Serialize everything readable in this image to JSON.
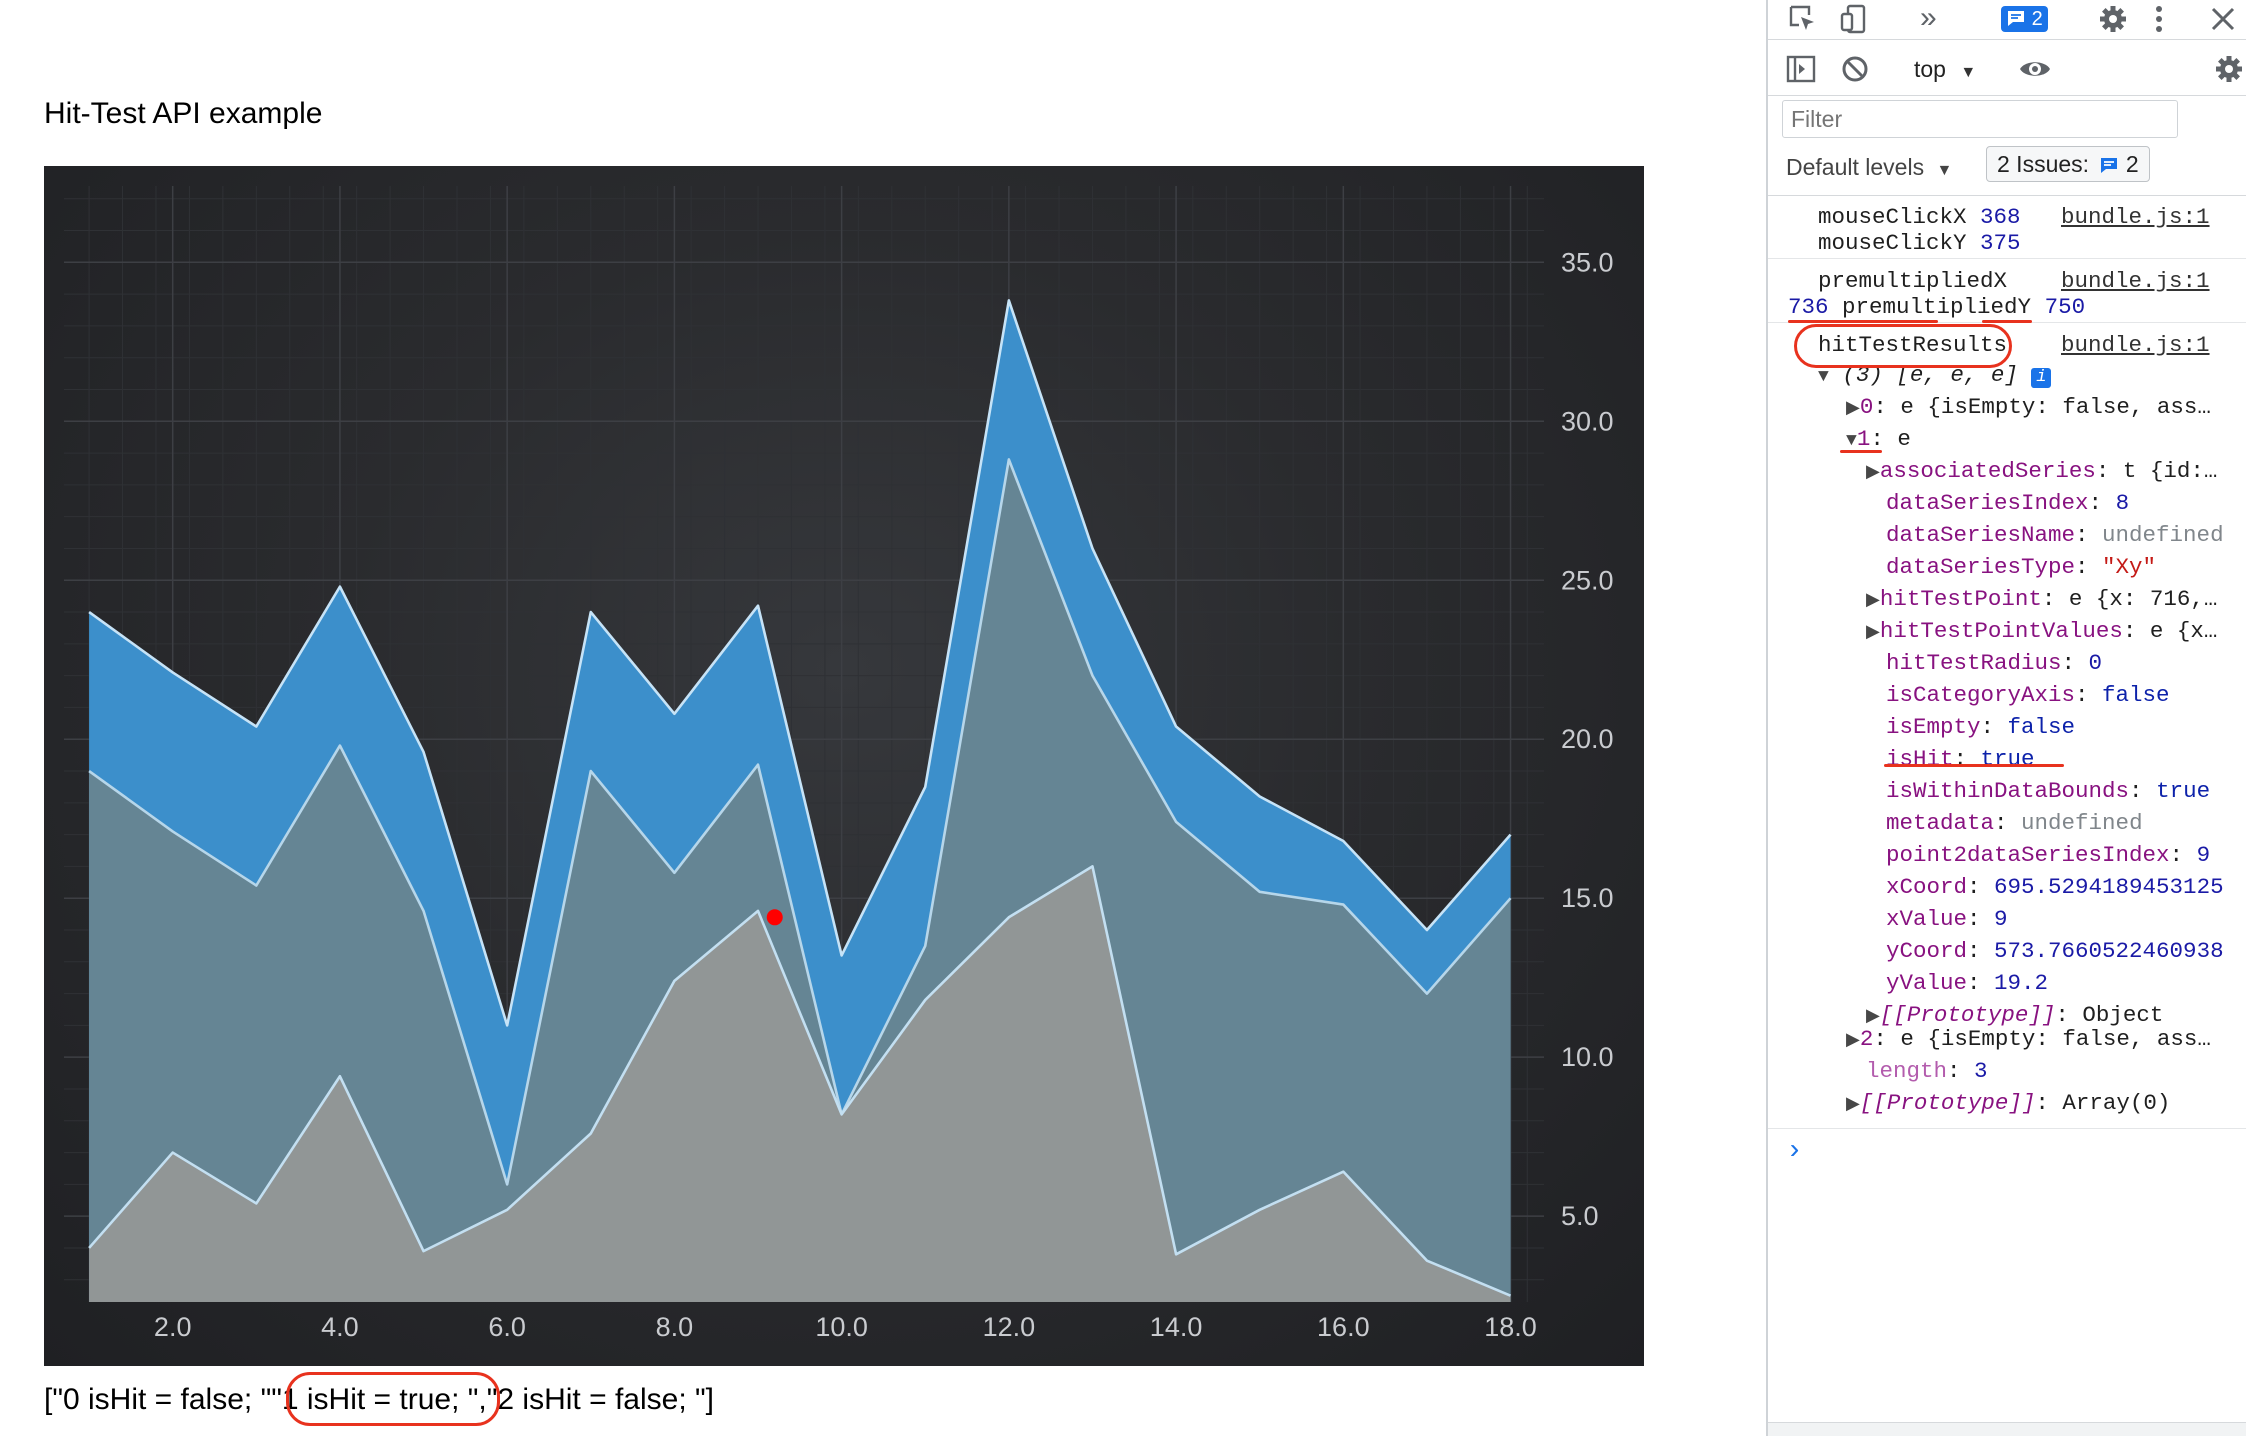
{
  "page": {
    "title": "Hit-Test API example",
    "result_parts": [
      "[\"0 isHit = false; \"",
      "\"1 isHit = true; \"",
      ",\"2 isHit = false; \"]"
    ],
    "point_marker_color": "#ff0000"
  },
  "chart_data": {
    "type": "area",
    "x": [
      1,
      2,
      3,
      4,
      5,
      6,
      7,
      8,
      9,
      10,
      11,
      12,
      13,
      14,
      15,
      16,
      17,
      18
    ],
    "ylim": [
      2.3,
      37.4
    ],
    "xlim": [
      0.7,
      18.4
    ],
    "y_ticks": [
      "35.0",
      "30.0",
      "25.0",
      "20.0",
      "15.0",
      "10.0",
      "5.0"
    ],
    "x_ticks": [
      "2.0",
      "4.0",
      "6.0",
      "8.0",
      "10.0",
      "12.0",
      "14.0",
      "16.0",
      "18.0"
    ],
    "series": [
      {
        "values": [
          24.0,
          22.1,
          20.4,
          24.8,
          19.6,
          11.0,
          24.0,
          20.8,
          24.2,
          13.2,
          18.5,
          33.8,
          26.0,
          20.4,
          18.2,
          16.8,
          14.0,
          17.0
        ],
        "fill": "#3c8fcb",
        "stroke": "#c6e3f7"
      },
      {
        "values": [
          19.0,
          17.1,
          15.4,
          19.8,
          14.6,
          6.0,
          19.0,
          15.8,
          19.2,
          8.2,
          13.5,
          28.8,
          22.0,
          17.4,
          15.2,
          14.8,
          12.0,
          15.0
        ],
        "fill": "#658594",
        "stroke": "#b6d6ea"
      },
      {
        "values": [
          4.0,
          7.0,
          5.4,
          9.4,
          3.9,
          5.2,
          7.6,
          12.4,
          14.6,
          8.2,
          11.8,
          14.4,
          16.0,
          3.8,
          5.2,
          6.4,
          3.6,
          2.5
        ],
        "fill": "#919696",
        "stroke": "#c3dff1"
      }
    ],
    "hit_point": {
      "x": 9.2,
      "y": 14.4
    },
    "grid": true
  },
  "devtools": {
    "issues_count": "2",
    "context_label": "top",
    "filter_placeholder": "Filter",
    "levels_label": "Default levels",
    "issues_label": "2 Issues:",
    "issues_badge": "2",
    "entries": {
      "e1_line1_key": "mouseClickX ",
      "e1_line1_val": "368",
      "e1_line2_key": "mouseClickY ",
      "e1_line2_val": "375",
      "e2_line1_key": "premultipliedX",
      "e2_line2_val1": "736",
      "e2_line2_key": " premultipliedY ",
      "e2_line2_val2": "750",
      "e3_label": "hitTestResults",
      "source": "bundle.js:1"
    },
    "tree": {
      "array_head": "(3) [e, e, e]",
      "info_badge": "i",
      "item0_key": "0",
      "item0_rest": ": e {isEmpty: false, ass…",
      "item1_key": "1",
      "item1_rest": ": e",
      "props": [
        {
          "key": "associatedSeries",
          "val": ": t {id:…",
          "kind": "obj",
          "expandable": true
        },
        {
          "key": "dataSeriesIndex",
          "val": "8",
          "kind": "num",
          "expandable": false
        },
        {
          "key": "dataSeriesName",
          "val": "undefined",
          "kind": "muted",
          "expandable": false
        },
        {
          "key": "dataSeriesType",
          "val": "\"Xy\"",
          "kind": "str",
          "expandable": false
        },
        {
          "key": "hitTestPoint",
          "val": ": e {x: 716,…",
          "kind": "obj",
          "expandable": true
        },
        {
          "key": "hitTestPointValues",
          "val": ": e {x…",
          "kind": "obj",
          "expandable": true
        },
        {
          "key": "hitTestRadius",
          "val": "0",
          "kind": "num",
          "expandable": false
        },
        {
          "key": "isCategoryAxis",
          "val": "false",
          "kind": "bool",
          "expandable": false
        },
        {
          "key": "isEmpty",
          "val": "false",
          "kind": "bool",
          "expandable": false
        },
        {
          "key": "isHit",
          "val": "true",
          "kind": "bool",
          "expandable": false
        },
        {
          "key": "isWithinDataBounds",
          "val": "true",
          "kind": "bool",
          "expandable": false
        },
        {
          "key": "metadata",
          "val": "undefined",
          "kind": "muted",
          "expandable": false
        },
        {
          "key": "point2dataSeriesIndex",
          "val": "9",
          "kind": "num",
          "expandable": false
        },
        {
          "key": "xCoord",
          "val": "695.5294189453125",
          "kind": "num",
          "expandable": false
        },
        {
          "key": "xValue",
          "val": "9",
          "kind": "num",
          "expandable": false
        },
        {
          "key": "yCoord",
          "val": "573.7660522460938",
          "kind": "num",
          "expandable": false
        },
        {
          "key": "yValue",
          "val": "19.2",
          "kind": "num",
          "expandable": false
        },
        {
          "key": "[[Prototype]]",
          "val": ": Object",
          "kind": "obj",
          "expandable": true
        }
      ],
      "item2_key": "2",
      "item2_rest": ": e {isEmpty: false, ass…",
      "length_key": "length",
      "length_val": "3",
      "proto_key": "[[Prototype]]",
      "proto_rest": ": Array(0)"
    },
    "prompt_caret": "›"
  }
}
